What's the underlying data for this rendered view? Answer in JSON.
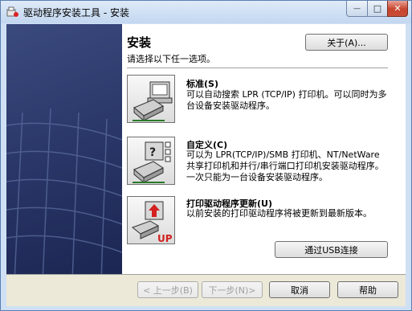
{
  "window": {
    "title": "驱动程序安装工具 - 安装",
    "buttons": {
      "minimize_glyph": "—",
      "maximize_glyph": "□",
      "close_glyph": "✕"
    }
  },
  "main": {
    "heading": "安装",
    "subheading": "请选择以下任一选项。",
    "about_label": "关于(A)...",
    "options": [
      {
        "title": "标准(S)",
        "description": "可以自动搜索 LPR (TCP/IP) 打印机。可以同时为多台设备安装驱动程序。",
        "icon": "printer-network-icon"
      },
      {
        "title": "自定义(C)",
        "description": "可以为 LPR(TCP/IP)/SMB 打印机、NT/NetWare 共享打印机和并行/串行端口打印机安装驱动程序。一次只能为一台设备安装驱动程序。",
        "icon": "printer-custom-icon"
      },
      {
        "title": "打印驱动程序更新(U)",
        "description": "以前安装的打印驱动程序将被更新到最新版本。",
        "icon": "printer-update-icon"
      }
    ],
    "usb_label": "通过USB连接",
    "update_badge": "UP"
  },
  "footer": {
    "back_label": "< 上一步(B)",
    "next_label": "下一步(N)>",
    "cancel_label": "取消",
    "help_label": "帮助"
  },
  "colors": {
    "left_panel": "#2b386a",
    "title_bar": "#c3d7f0",
    "close_button": "#c7432c",
    "badge": "#d42020"
  }
}
